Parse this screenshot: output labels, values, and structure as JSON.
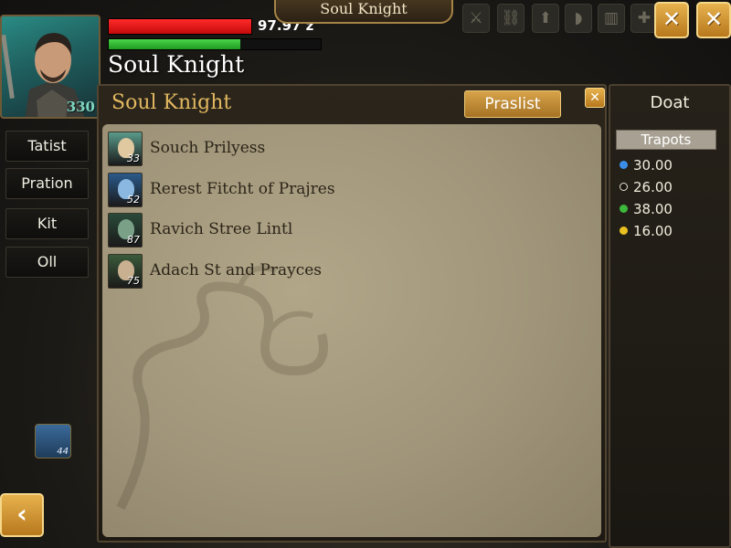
{
  "hud": {
    "hero_name": "Soul Knight",
    "hero_level": "330",
    "hp_text": "97.97 z",
    "hp_fraction": 1.0,
    "mp_fraction": 0.62,
    "banner_title": "Soul Knight"
  },
  "top_icons": [
    {
      "name": "sword-icon",
      "glyph": "⚔"
    },
    {
      "name": "chain-icon",
      "glyph": "⛓"
    },
    {
      "name": "arrow-up-icon",
      "glyph": "⬆"
    },
    {
      "name": "boot-icon",
      "glyph": "◗"
    },
    {
      "name": "chart-icon",
      "glyph": "▥"
    },
    {
      "name": "puzzle-icon",
      "glyph": "✚"
    }
  ],
  "close_buttons": {
    "glyph": "✕"
  },
  "side_tabs": [
    "Tatist",
    "Pration",
    "Kit",
    "Oll"
  ],
  "bottom_left": {
    "glyph": "‹",
    "mini_icon_level": "44"
  },
  "panel": {
    "title": "Soul Knight",
    "button_label": "Praslist",
    "close_glyph": "✕",
    "rows": [
      {
        "text": "Souch Prilyess",
        "level": "33",
        "bg": "#5a9a8a",
        "face": "#e0c8a0"
      },
      {
        "text": "Rerest Fitcht of Prajres",
        "level": "52",
        "bg": "#2a5a8a",
        "face": "#8ab8e0"
      },
      {
        "text": "Ravich Stree Lintl",
        "level": "87",
        "bg": "#2a4a3a",
        "face": "#7aa088"
      },
      {
        "text": "Adach St and Prayces",
        "level": "75",
        "bg": "#3a5a3a",
        "face": "#c8b090"
      }
    ]
  },
  "stats_panel": {
    "title": "Doat",
    "subtitle": "Trapots",
    "stats": [
      {
        "value": "30.00",
        "color": "#3a8ee8",
        "hollow": false
      },
      {
        "value": "26.00",
        "color": "#1a1712",
        "hollow": true
      },
      {
        "value": "38.00",
        "color": "#3cb83c",
        "hollow": false
      },
      {
        "value": "16.00",
        "color": "#e8c020",
        "hollow": false
      }
    ]
  }
}
